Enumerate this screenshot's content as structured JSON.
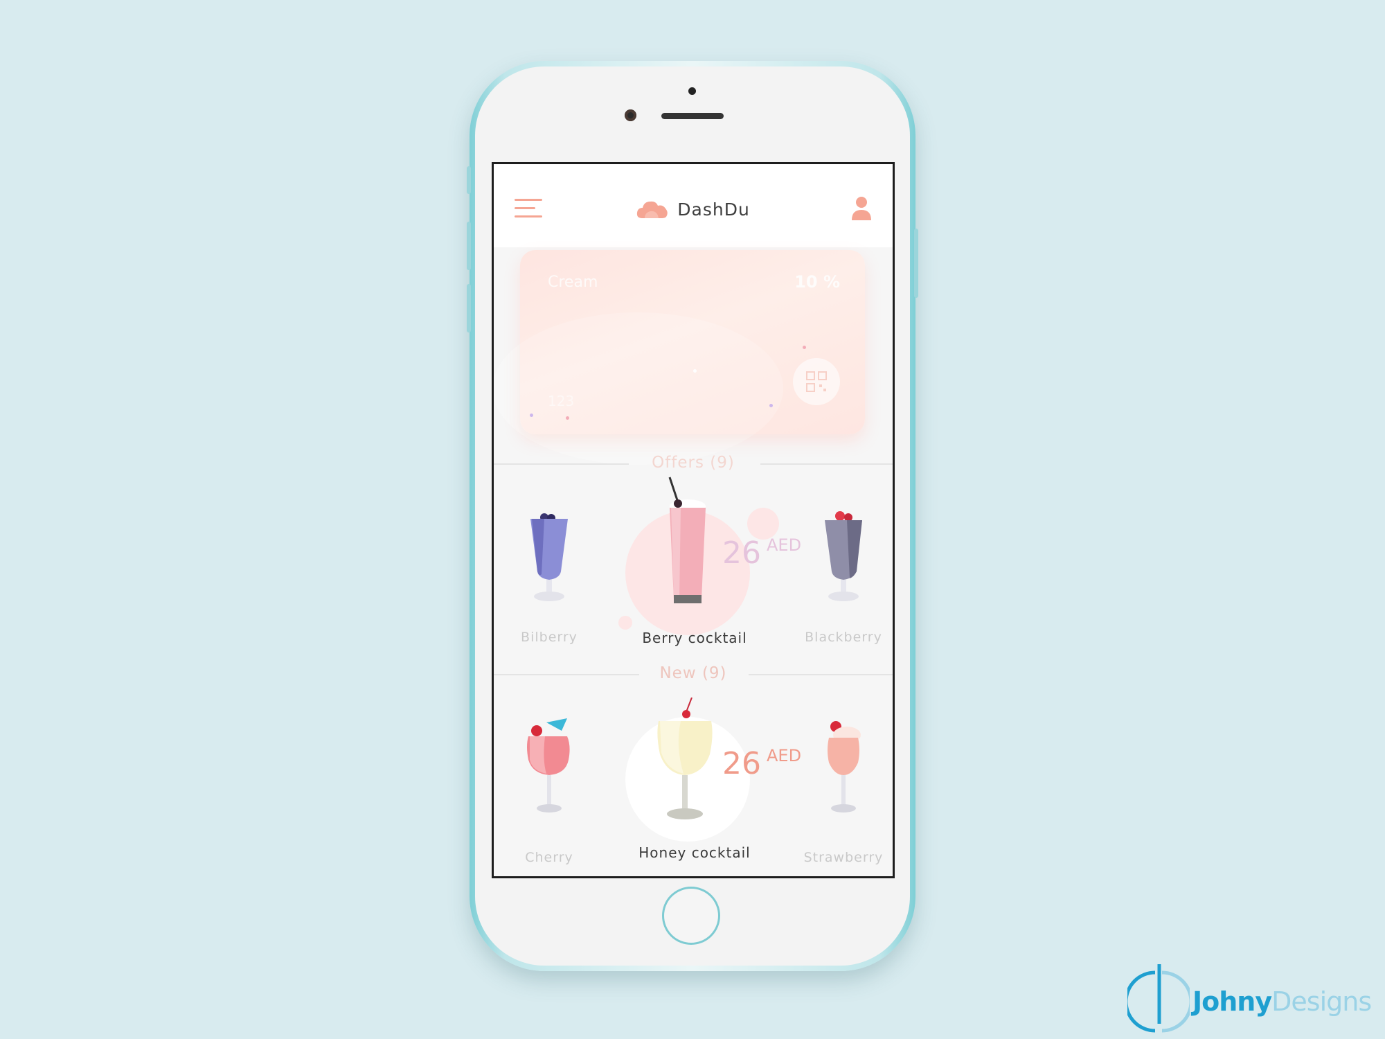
{
  "app": {
    "brand_name": "DashDu",
    "accent_color": "#f5a593",
    "icons": {
      "menu": "hamburger-icon",
      "brand": "cloud-icon",
      "profile": "user-icon",
      "qr": "qr-code-icon"
    }
  },
  "card": {
    "name": "Cream",
    "discount": "10 %",
    "number": "123"
  },
  "offers": {
    "title": "Offers (9)",
    "items": [
      {
        "label": "Bilberry"
      },
      {
        "label": "Berry cocktail",
        "price": "26",
        "currency": "AED"
      },
      {
        "label": "Blackberry"
      }
    ]
  },
  "new": {
    "title": "New (9)",
    "items": [
      {
        "label": "Cherry"
      },
      {
        "label": "Honey cocktail",
        "price": "26",
        "currency": "AED"
      },
      {
        "label": "Strawberry"
      }
    ]
  },
  "watermark": {
    "part1": "Johny",
    "part2": "Designs"
  }
}
